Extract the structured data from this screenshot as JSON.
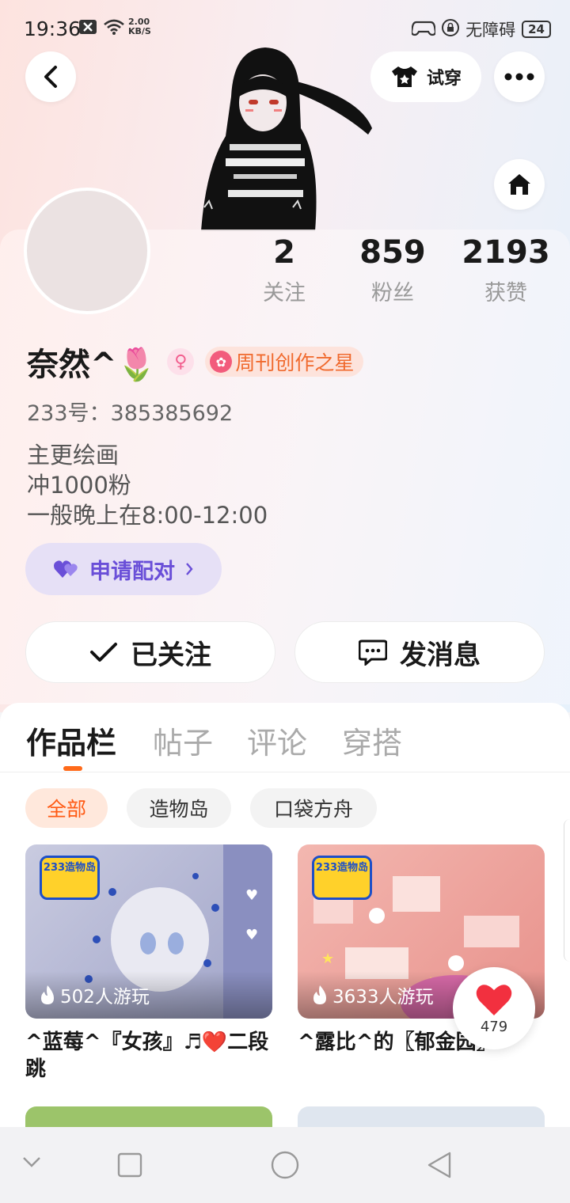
{
  "status_bar": {
    "time": "19:36",
    "speed_value": "2.00",
    "speed_unit": "KB/S",
    "accessibility": "无障碍",
    "battery": "24"
  },
  "top": {
    "try_on_label": "试穿"
  },
  "stats": [
    {
      "value": "2",
      "label": "关注"
    },
    {
      "value": "859",
      "label": "粉丝"
    },
    {
      "value": "2193",
      "label": "获赞"
    }
  ],
  "profile": {
    "name": "奈然^🌷",
    "badge": "周刊创作之星",
    "id": "233号：385385692",
    "bio": [
      "主更绘画",
      "冲1000粉",
      "一般晚上在8:00-12:00"
    ],
    "pair_label": "申请配对"
  },
  "actions": {
    "follow_label": "已关注",
    "message_label": "发消息"
  },
  "tabs": [
    "作品栏",
    "帖子",
    "评论",
    "穿搭"
  ],
  "chips": [
    "全部",
    "造物岛",
    "口袋方舟"
  ],
  "works": [
    {
      "play": "502人游玩",
      "title": "^蓝莓^『女孩』♬❤️二段跳",
      "logo": "233造物岛"
    },
    {
      "play": "3633人游玩",
      "title": "^露比^的〖郁金园〗",
      "logo": "233造物岛"
    }
  ],
  "like_count": "479",
  "colors": {
    "accent_orange": "#ff5a14",
    "pair_purple": "#6a4fd8",
    "badge_orange": "#f06a2e"
  }
}
